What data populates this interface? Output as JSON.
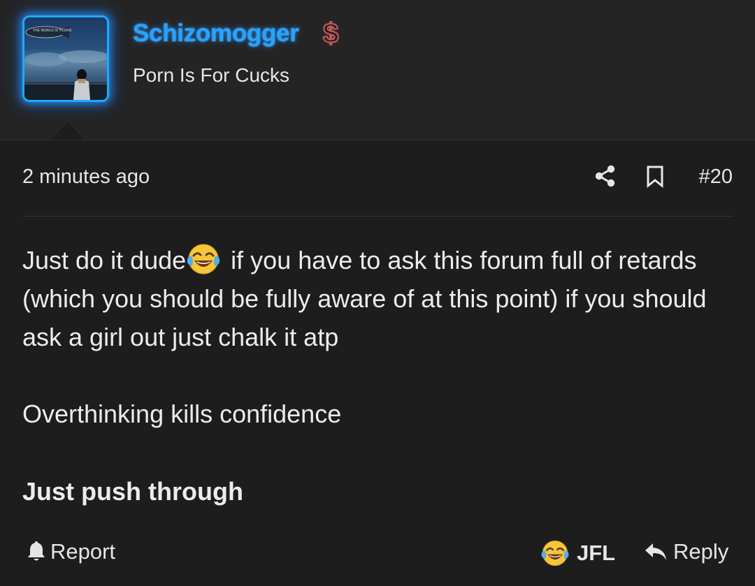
{
  "user": {
    "name": "Schizomogger",
    "title": "Porn Is For Cucks",
    "badge_icon": "dollar-sign-icon",
    "avatar_caption": "THE WORLD IS YOURS",
    "name_color": "#2aa2ff",
    "badge_color": "#c85b5b"
  },
  "post": {
    "time": "2 minutes ago",
    "number": "#20",
    "share_icon": "share-icon",
    "bookmark_icon": "bookmark-icon"
  },
  "message": {
    "line1_before": "Just do it dude",
    "emoji": "joy-emoji",
    "line1_after": " if you have to ask this forum full of retards (which you should be fully aware of at this point) if you should ask a girl out just chalk it atp",
    "line2": "Overthinking kills confidence",
    "line3": "Just push through"
  },
  "actions": {
    "report": "Report",
    "reaction": "JFL",
    "reply": "Reply",
    "report_icon": "bell-icon",
    "reaction_icon": "joy-emoji",
    "reply_icon": "reply-arrow-icon"
  },
  "colors": {
    "background": "#1d1d1e",
    "header_background": "#242425",
    "text": "#e9e9ea",
    "avatar_glow": "#20a8ff"
  }
}
